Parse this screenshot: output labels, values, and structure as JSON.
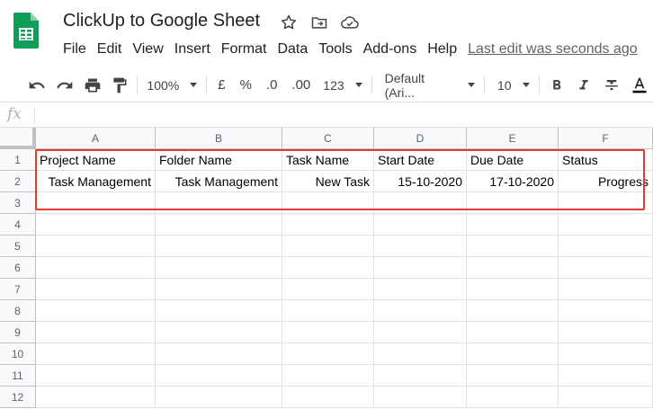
{
  "doc": {
    "title": "ClickUp to Google Sheet",
    "last_edit": "Last edit was seconds ago"
  },
  "menu": [
    "File",
    "Edit",
    "View",
    "Insert",
    "Format",
    "Data",
    "Tools",
    "Add-ons",
    "Help"
  ],
  "toolbar": {
    "zoom": "100%",
    "currency": "£",
    "percent": "%",
    "decrease_decimal": ".0",
    "increase_decimal": ".00",
    "more_formats": "123",
    "font": "Default (Ari...",
    "font_size": "10"
  },
  "formula_bar": {
    "label": "fx"
  },
  "sheet": {
    "columns": [
      "A",
      "B",
      "C",
      "D",
      "E",
      "F"
    ],
    "rows": [
      "1",
      "2",
      "3",
      "4",
      "5",
      "6",
      "7",
      "8",
      "9",
      "10",
      "11",
      "12"
    ],
    "cells": [
      [
        "Project Name",
        "Folder Name",
        "Task Name",
        "Start Date",
        "Due Date",
        "Status"
      ],
      [
        "Task Management",
        "Task Management",
        "New Task",
        "15-10-2020",
        "17-10-2020",
        "Progress"
      ]
    ]
  },
  "colors": {
    "highlight": "#e53935",
    "sheets_green": "#0f9d58"
  }
}
